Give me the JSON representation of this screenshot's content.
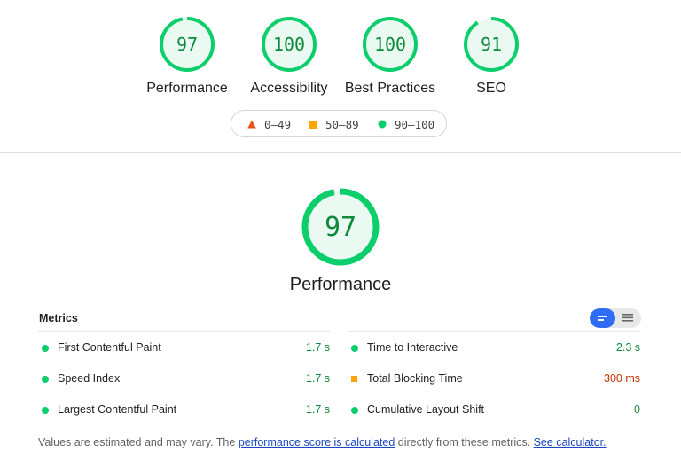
{
  "colors": {
    "pass": "#0cce6b",
    "pass_text": "#0c8a3a",
    "average": "#ffa400",
    "average_text": "#c33300",
    "fail": "#ff4e42",
    "link": "#1a48bf",
    "toggle_active": "#2f6df6"
  },
  "summary": {
    "gauges": [
      {
        "score": "97",
        "label": "Performance",
        "fraction": 0.97
      },
      {
        "score": "100",
        "label": "Accessibility",
        "fraction": 1.0
      },
      {
        "score": "100",
        "label": "Best Practices",
        "fraction": 1.0
      },
      {
        "score": "91",
        "label": "SEO",
        "fraction": 0.91
      }
    ]
  },
  "legend": {
    "fail": "0–49",
    "average": "50–89",
    "pass": "90–100"
  },
  "category": {
    "score": "97",
    "fraction": 0.97,
    "title": "Performance"
  },
  "metrics": {
    "heading": "Metrics",
    "left": [
      {
        "name": "First Contentful Paint",
        "value": "1.7 s",
        "status": "pass"
      },
      {
        "name": "Speed Index",
        "value": "1.7 s",
        "status": "pass"
      },
      {
        "name": "Largest Contentful Paint",
        "value": "1.7 s",
        "status": "pass"
      }
    ],
    "right": [
      {
        "name": "Time to Interactive",
        "value": "2.3 s",
        "status": "pass"
      },
      {
        "name": "Total Blocking Time",
        "value": "300 ms",
        "status": "average"
      },
      {
        "name": "Cumulative Layout Shift",
        "value": "0",
        "status": "pass"
      }
    ]
  },
  "footnote": {
    "text1": "Values are estimated and may vary. The ",
    "link1": "performance score is calculated",
    "text2": " directly from these metrics. ",
    "link2": "See calculator."
  }
}
